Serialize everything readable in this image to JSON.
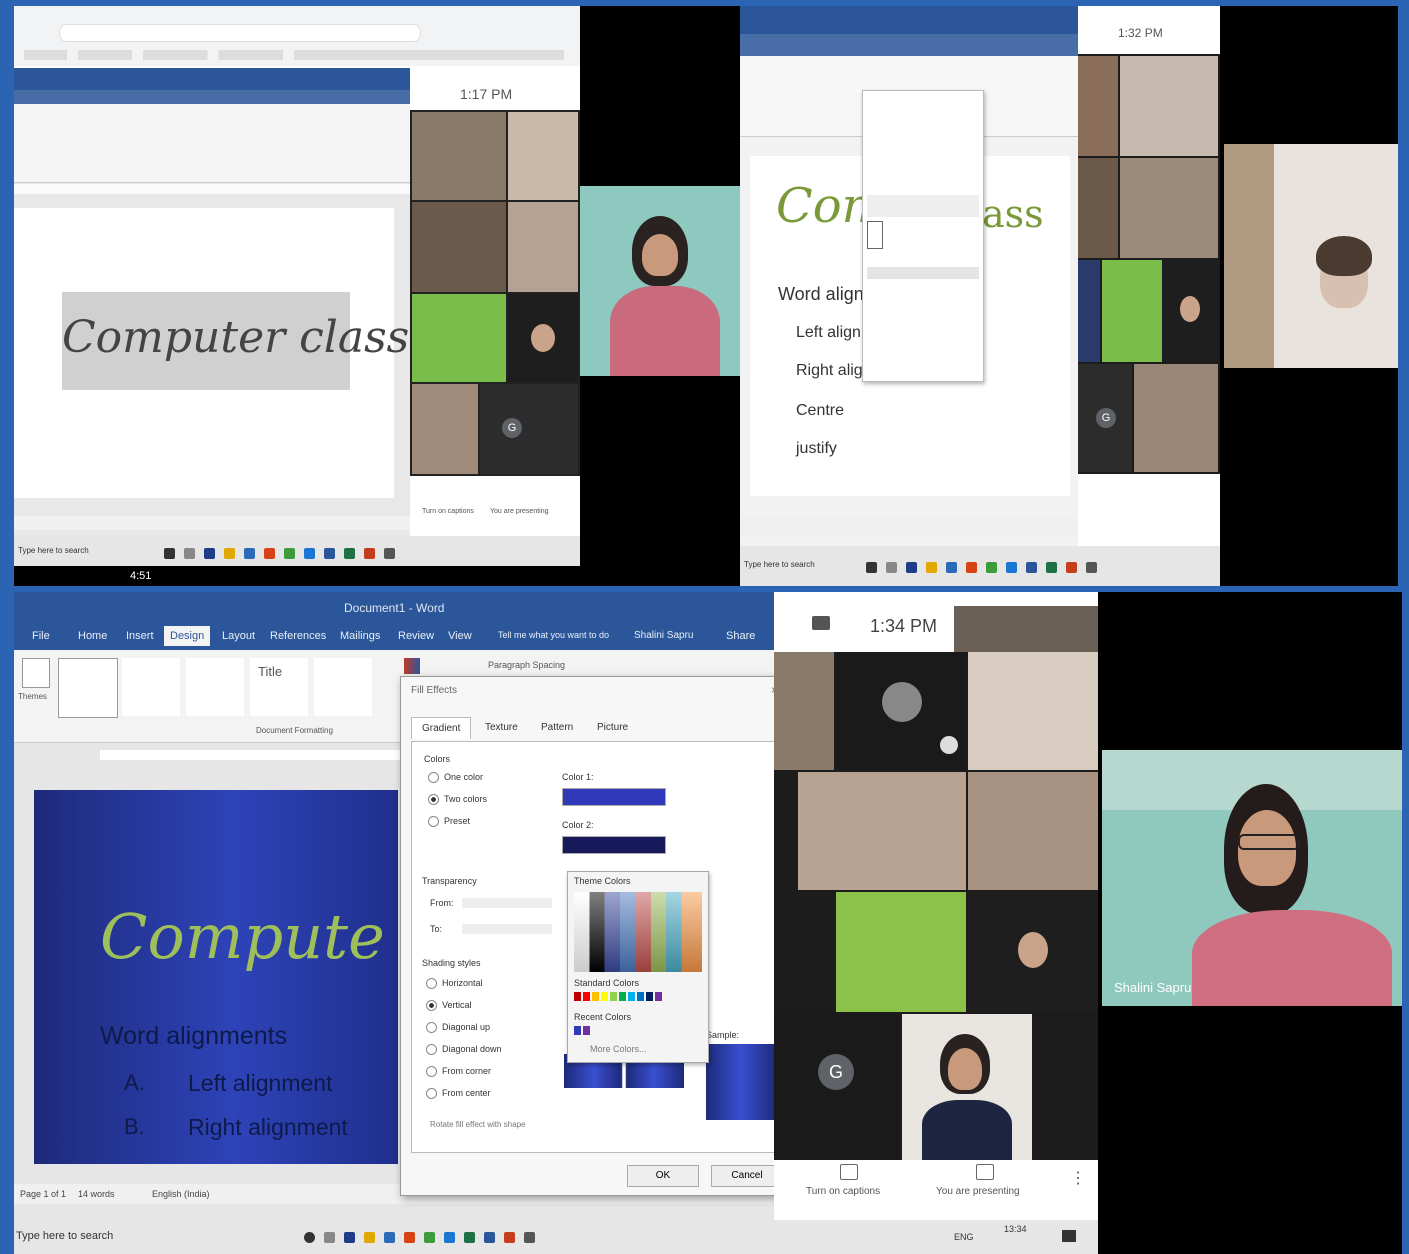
{
  "panel1": {
    "doc_title": "Computer class",
    "clock": "1:17 PM",
    "captions_label": "Turn on captions",
    "present_label": "You are presenting",
    "overlay_time": "4:51",
    "search_placeholder": "Type here to search",
    "avatar_letter": "G"
  },
  "panel2": {
    "clock": "1:32 PM",
    "heading_partial_left": "Comp",
    "heading_partial_right": "ass",
    "heading": "Word alignmen",
    "bullets": [
      "Left alignme",
      "Right align...",
      "Centre",
      "justify"
    ],
    "avatar_letter": "G",
    "search_placeholder": "Type here to search"
  },
  "panel3": {
    "window_title": "Document1 - Word",
    "tabs": [
      "File",
      "Home",
      "Insert",
      "Design",
      "Layout",
      "References",
      "Mailings",
      "Review",
      "View"
    ],
    "tell_me": "Tell me what you want to do",
    "user_name": "Shalini Sapru",
    "share_label": "Share",
    "themes_label": "Themes",
    "style_title_label": "Title",
    "paragraph_spacing": "Paragraph Spacing",
    "document_formatting": "Document Formatting",
    "slide_title": "Compute",
    "slide_heading": "Word alignments",
    "slide_list": [
      {
        "marker": "A.",
        "text": "Left alignment"
      },
      {
        "marker": "B.",
        "text": "Right alignment"
      }
    ],
    "status_page": "Page 1 of 1",
    "status_words": "14 words",
    "status_lang": "English (India)",
    "search_placeholder": "Type here to search",
    "clock": "1:34 PM",
    "presenter_name": "Shalini Sapru",
    "avatar_letter": "G",
    "captions_label": "Turn on captions",
    "present_label": "You are presenting",
    "tray_lang": "ENG",
    "tray_time": "13:34",
    "dialog": {
      "title": "Fill Effects",
      "tabs": [
        "Gradient",
        "Texture",
        "Pattern",
        "Picture"
      ],
      "colors_label": "Colors",
      "color_options": [
        "One color",
        "Two colors",
        "Preset"
      ],
      "color1_label": "Color 1:",
      "color2_label": "Color 2:",
      "transparency_label": "Transparency",
      "from_label": "From:",
      "to_label": "To:",
      "shading_label": "Shading styles",
      "shading_options": [
        "Horizontal",
        "Vertical",
        "Diagonal up",
        "Diagonal down",
        "From corner",
        "From center"
      ],
      "rotate_label": "Rotate fill effect with shape",
      "theme_colors": "Theme Colors",
      "standard_colors": "Standard Colors",
      "recent_colors": "Recent Colors",
      "more_colors": "More Colors...",
      "sample_label": "Sample:",
      "ok": "OK",
      "cancel": "Cancel"
    }
  }
}
